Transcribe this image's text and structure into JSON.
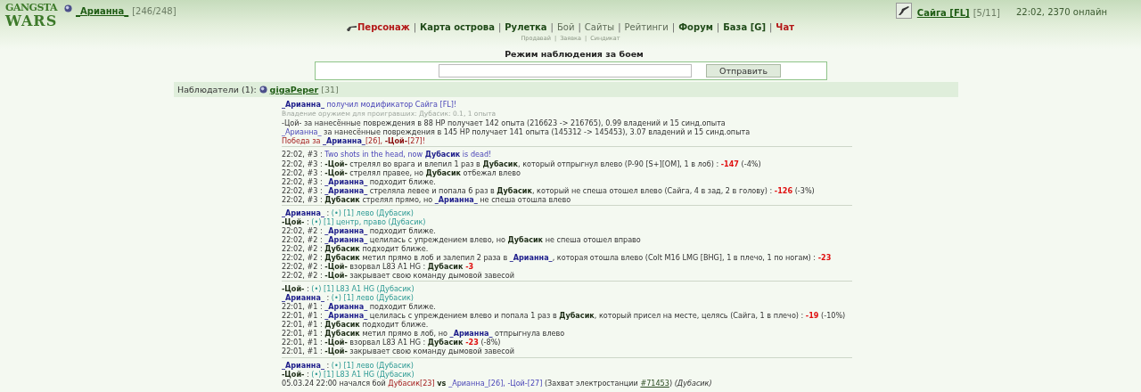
{
  "logo": {
    "lines": [
      "GANGSTA",
      "WARS"
    ]
  },
  "user": {
    "name": "_Арианна_",
    "hp": "[246/248]"
  },
  "nav": {
    "separator": "|",
    "items": [
      {
        "label": "Персонаж",
        "kind": "alert",
        "icon": true
      },
      {
        "label": "Карта острова",
        "kind": "bold"
      },
      {
        "label": "Рулетка",
        "kind": "bold"
      },
      {
        "label": "Бой",
        "kind": "plain"
      },
      {
        "label": "Сайты",
        "kind": "plain"
      },
      {
        "label": "Рейтинги",
        "kind": "plain"
      },
      {
        "label": "Форум",
        "kind": "bold"
      },
      {
        "label": "База [G]",
        "kind": "bold"
      },
      {
        "label": "Чат",
        "kind": "alert"
      }
    ],
    "subitems": [
      "Продавай",
      "Заявка",
      "Синдикат"
    ]
  },
  "weapon": {
    "name": "Сайга [FL]",
    "count": "[5/11]"
  },
  "status": "22:02, 2370 онлайн",
  "battle": {
    "title": "Режим наблюдения за боем",
    "button": "Отправить"
  },
  "observers": {
    "label": "Наблюдатели (1):",
    "items": [
      {
        "name": "gigaPeper",
        "level": "[31]"
      }
    ]
  },
  "log": [
    {
      "lines": [
        [
          {
            "kind": "hero",
            "text": "_Арианна_"
          },
          {
            "kind": "event",
            "text": " получил модификатор Сайга [FL]!"
          }
        ],
        [
          {
            "kind": "note",
            "text": "Владение оружием для проигравших: Дубасик: 0.1, 1 опыта"
          }
        ],
        [
          {
            "kind": "plain",
            "text": "-Цой- за нанесённые повреждения в 88 HP получает 142 опыта (216623 -> 216765), 0.99 владений и 15 синд.опыта"
          }
        ],
        [
          {
            "kind": "event",
            "text": "_Арианна_"
          },
          {
            "kind": "plain",
            "text": " за нанесённые повреждения в 145 HP получает 141 опыта (145312 -> 145453), 3.07 владений и 15 синд.опыта"
          }
        ],
        [
          {
            "kind": "victory",
            "text": "Победа за "
          },
          {
            "kind": "hero",
            "text": "_Арианна_"
          },
          {
            "kind": "victory",
            "text": "[26], "
          },
          {
            "kind": "victory-bold",
            "text": "-Цой-"
          },
          {
            "kind": "victory",
            "text": "[27]!"
          }
        ]
      ]
    },
    {
      "lines": [
        [
          {
            "kind": "plain",
            "text": "22:02, #3 : "
          },
          {
            "kind": "event",
            "text": "Two shots in the head, now "
          },
          {
            "kind": "hero",
            "text": "Дубасик"
          },
          {
            "kind": "event",
            "text": " is dead!"
          }
        ],
        [
          {
            "kind": "plain",
            "text": "22:02, #3 : "
          },
          {
            "kind": "fighter",
            "text": "-Цой-"
          },
          {
            "kind": "plain",
            "text": " стрелял во врага и влепил 1 раз в "
          },
          {
            "kind": "fighter",
            "text": "Дубасик"
          },
          {
            "kind": "plain",
            "text": ", который отпрыгнул влево (P-90 [S+][OM], 1 в лоб) : "
          },
          {
            "kind": "damage",
            "text": "-147"
          },
          {
            "kind": "plain",
            "text": " (-4%)"
          }
        ],
        [
          {
            "kind": "plain",
            "text": "22:02, #3 : "
          },
          {
            "kind": "fighter",
            "text": "-Цой-"
          },
          {
            "kind": "plain",
            "text": " стрелял правее, но "
          },
          {
            "kind": "fighter",
            "text": "Дубасик"
          },
          {
            "kind": "plain",
            "text": " отбежал влево"
          }
        ],
        [
          {
            "kind": "plain",
            "text": "22:02, #3 : "
          },
          {
            "kind": "hero",
            "text": "_Арианна_"
          },
          {
            "kind": "plain",
            "text": " подходит ближе."
          }
        ],
        [
          {
            "kind": "plain",
            "text": "22:02, #3 : "
          },
          {
            "kind": "hero",
            "text": "_Арианна_"
          },
          {
            "kind": "plain",
            "text": " стреляла левее и попала 6 раз в "
          },
          {
            "kind": "fighter",
            "text": "Дубасик"
          },
          {
            "kind": "plain",
            "text": ", который не спеша отошел влево (Сайга, 4 в зад, 2 в голову) : "
          },
          {
            "kind": "damage",
            "text": "-126"
          },
          {
            "kind": "plain",
            "text": " (-3%)"
          }
        ],
        [
          {
            "kind": "plain",
            "text": "22:02, #3 : "
          },
          {
            "kind": "fighter",
            "text": "Дубасик"
          },
          {
            "kind": "plain",
            "text": " стрелял прямо, но "
          },
          {
            "kind": "hero",
            "text": "_Арианна_"
          },
          {
            "kind": "plain",
            "text": " не спеша отошла влево"
          }
        ]
      ]
    },
    {
      "lines": [
        [
          {
            "kind": "hero",
            "text": "_Арианна_"
          },
          {
            "kind": "plain",
            "text": " : "
          },
          {
            "kind": "action",
            "text": "(•) [1] лево (Дубасик)"
          }
        ],
        [
          {
            "kind": "fighter",
            "text": "-Цой-"
          },
          {
            "kind": "plain",
            "text": " : "
          },
          {
            "kind": "action",
            "text": "(•) [1] центр, право (Дубасик)"
          }
        ],
        [
          {
            "kind": "plain",
            "text": "22:02, #2 : "
          },
          {
            "kind": "hero",
            "text": "_Арианна_"
          },
          {
            "kind": "plain",
            "text": " подходит ближе."
          }
        ],
        [
          {
            "kind": "plain",
            "text": "22:02, #2 : "
          },
          {
            "kind": "hero",
            "text": "_Арианна_"
          },
          {
            "kind": "plain",
            "text": " целилась с упреждением влево, но "
          },
          {
            "kind": "fighter",
            "text": "Дубасик"
          },
          {
            "kind": "plain",
            "text": " не спеша отошел вправо"
          }
        ],
        [
          {
            "kind": "plain",
            "text": "22:02, #2 : "
          },
          {
            "kind": "fighter",
            "text": "Дубасик"
          },
          {
            "kind": "plain",
            "text": " подходит ближе."
          }
        ],
        [
          {
            "kind": "plain",
            "text": "22:02, #2 : "
          },
          {
            "kind": "fighter",
            "text": "Дубасик"
          },
          {
            "kind": "plain",
            "text": " метил прямо в лоб и залепил 2 раза в "
          },
          {
            "kind": "hero",
            "text": "_Арианна_"
          },
          {
            "kind": "plain",
            "text": ", которая отошла влево (Colt M16 LMG [BHG], 1 в плечо, 1 по ногам) : "
          },
          {
            "kind": "damage",
            "text": "-23"
          }
        ],
        [
          {
            "kind": "plain",
            "text": "22:02, #2 : "
          },
          {
            "kind": "fighter",
            "text": "-Цой-"
          },
          {
            "kind": "plain",
            "text": " взорвал L83 A1 HG : "
          },
          {
            "kind": "fighter",
            "text": "Дубасик "
          },
          {
            "kind": "damage",
            "text": "-3"
          }
        ],
        [
          {
            "kind": "plain",
            "text": "22:02, #2 : "
          },
          {
            "kind": "fighter",
            "text": "-Цой-"
          },
          {
            "kind": "plain",
            "text": " закрывает свою команду дымовой завесой"
          }
        ]
      ]
    },
    {
      "lines": [
        [
          {
            "kind": "fighter",
            "text": "-Цой-"
          },
          {
            "kind": "plain",
            "text": " : "
          },
          {
            "kind": "action",
            "text": "(•) [1] L83 A1 HG (Дубасик)"
          }
        ],
        [
          {
            "kind": "hero",
            "text": "_Арианна_"
          },
          {
            "kind": "plain",
            "text": " : "
          },
          {
            "kind": "action",
            "text": "(•) [1] лево (Дубасик)"
          }
        ],
        [
          {
            "kind": "plain",
            "text": "22:01, #1 : "
          },
          {
            "kind": "hero",
            "text": "_Арианна_"
          },
          {
            "kind": "plain",
            "text": " подходит ближе."
          }
        ],
        [
          {
            "kind": "plain",
            "text": "22:01, #1 : "
          },
          {
            "kind": "hero",
            "text": "_Арианна_"
          },
          {
            "kind": "plain",
            "text": " целилась с упреждением влево и попала 1 раз в "
          },
          {
            "kind": "fighter",
            "text": "Дубасик"
          },
          {
            "kind": "plain",
            "text": ", который присел на месте, целясь (Сайга, 1 в плечо) : "
          },
          {
            "kind": "damage",
            "text": "-19"
          },
          {
            "kind": "plain",
            "text": " (-10%)"
          }
        ],
        [
          {
            "kind": "plain",
            "text": "22:01, #1 : "
          },
          {
            "kind": "fighter",
            "text": "Дубасик"
          },
          {
            "kind": "plain",
            "text": " подходит ближе."
          }
        ],
        [
          {
            "kind": "plain",
            "text": "22:01, #1 : "
          },
          {
            "kind": "fighter",
            "text": "Дубасик"
          },
          {
            "kind": "plain",
            "text": " метил прямо в лоб, но "
          },
          {
            "kind": "hero",
            "text": "_Арианна_"
          },
          {
            "kind": "plain",
            "text": " отпрыгнула влево"
          }
        ],
        [
          {
            "kind": "plain",
            "text": "22:01, #1 : "
          },
          {
            "kind": "fighter",
            "text": "-Цой-"
          },
          {
            "kind": "plain",
            "text": " взорвал L83 A1 HG : "
          },
          {
            "kind": "fighter",
            "text": "Дубасик "
          },
          {
            "kind": "damage",
            "text": "-23"
          },
          {
            "kind": "plain",
            "text": " (-8%)"
          }
        ],
        [
          {
            "kind": "plain",
            "text": "22:01, #1 : "
          },
          {
            "kind": "fighter",
            "text": "-Цой-"
          },
          {
            "kind": "plain",
            "text": " закрывает свою команду дымовой завесой"
          }
        ]
      ]
    },
    {
      "lines": [
        [
          {
            "kind": "hero",
            "text": "_Арианна_"
          },
          {
            "kind": "plain",
            "text": " : "
          },
          {
            "kind": "action",
            "text": "(•) [1] лево (Дубасик)"
          }
        ],
        [
          {
            "kind": "fighter",
            "text": "-Цой-"
          },
          {
            "kind": "plain",
            "text": " : "
          },
          {
            "kind": "action",
            "text": "(•) [1] L83 A1 HG (Дубасик)"
          }
        ],
        [
          {
            "kind": "plain",
            "text": "05.03.24 22:00 начался бой "
          },
          {
            "kind": "victory",
            "text": "Дубасик[23] "
          },
          {
            "kind": "fighter",
            "text": "vs "
          },
          {
            "kind": "event",
            "text": "_Арианна_[26], -Цой-[27]"
          },
          {
            "kind": "plain",
            "text": " (Захват электростанции "
          },
          {
            "kind": "link",
            "text": "#71453"
          },
          {
            "kind": "plain",
            "text": ") "
          },
          {
            "kind": "italic",
            "text": "(Дубасик)"
          }
        ]
      ]
    }
  ]
}
